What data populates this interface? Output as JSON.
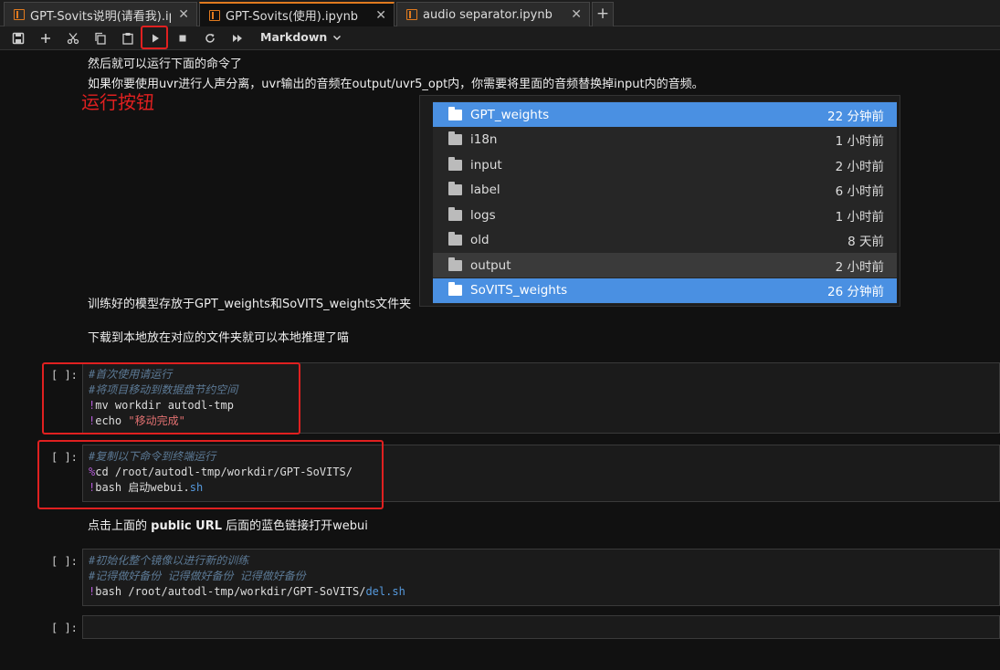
{
  "tabs": [
    {
      "label": "GPT-Sovits说明(请看我).ipynb",
      "active": false
    },
    {
      "label": "GPT-Sovits(使用).ipynb",
      "active": true
    },
    {
      "label": "audio separator.ipynb",
      "active": false
    }
  ],
  "tab_add": "+",
  "toolbar": {
    "cell_type": "Markdown",
    "buttons": [
      "save-icon",
      "add-icon",
      "cut-icon",
      "copy-icon",
      "paste-icon",
      "run-icon",
      "stop-icon",
      "restart-icon",
      "fast-forward-icon"
    ]
  },
  "markdown": {
    "line1": "然后就可以运行下面的命令了",
    "line2": "如果你要使用uvr进行人声分离，uvr输出的音频在output/uvr5_opt内，你需要将里面的音频替换掉input内的音频。",
    "line3": "训练好的模型存放于GPT_weights和SoVITS_weights文件夹",
    "line4": "下载到本地放在对应的文件夹就可以本地推理了喵",
    "line5_pre": "点击上面的 ",
    "line5_bold": "public URL",
    "line5_post": " 后面的蓝色链接打开webui"
  },
  "annotation": "运行按钮",
  "file_browser": [
    {
      "name": "GPT_weights",
      "time": "22 分钟前",
      "state": "selected"
    },
    {
      "name": "i18n",
      "time": "1 小时前",
      "state": ""
    },
    {
      "name": "input",
      "time": "2 小时前",
      "state": ""
    },
    {
      "name": "label",
      "time": "6 小时前",
      "state": ""
    },
    {
      "name": "logs",
      "time": "1 小时前",
      "state": ""
    },
    {
      "name": "old",
      "time": "8 天前",
      "state": ""
    },
    {
      "name": "output",
      "time": "2 小时前",
      "state": "hover"
    },
    {
      "name": "SoVITS_weights",
      "time": "26 分钟前",
      "state": "selected"
    }
  ],
  "cells": [
    {
      "prompt": "[ ]:",
      "lines": [
        [
          [
            "cm",
            "#首次使用请运行"
          ]
        ],
        [
          [
            "cm",
            "#将项目移动到数据盘节约空间"
          ]
        ],
        [
          [
            "bang",
            "!"
          ],
          [
            "",
            "mv workdir autodl-tmp"
          ]
        ],
        [
          [
            "bang",
            "!"
          ],
          [
            "",
            "echo "
          ],
          [
            "str",
            "\"移动完成\""
          ]
        ]
      ]
    },
    {
      "prompt": "[ ]:",
      "lines": [
        [
          [
            "cm",
            "#复制以下命令到终端运行"
          ]
        ],
        [
          [
            "pct",
            "%"
          ],
          [
            "",
            "cd /root/autodl-tmp/workdir/GPT-SoVITS/"
          ]
        ],
        [
          [
            "bang",
            "!"
          ],
          [
            "",
            "bash 启动webui."
          ],
          [
            "kw",
            "sh"
          ]
        ]
      ]
    },
    {
      "prompt": "[ ]:",
      "lines": [
        [
          [
            "cm",
            "#初始化整个镜像以进行新的训练"
          ]
        ],
        [
          [
            "cm",
            "#记得做好备份 记得做好备份 记得做好备份"
          ]
        ],
        [
          [
            "bang",
            "!"
          ],
          [
            "",
            "bash /root/autodl-tmp/workdir/GPT-SoVITS/"
          ],
          [
            "kw",
            "del.sh"
          ]
        ]
      ]
    },
    {
      "prompt": "[ ]:",
      "lines": [
        [
          [
            "",
            ""
          ]
        ]
      ]
    }
  ]
}
